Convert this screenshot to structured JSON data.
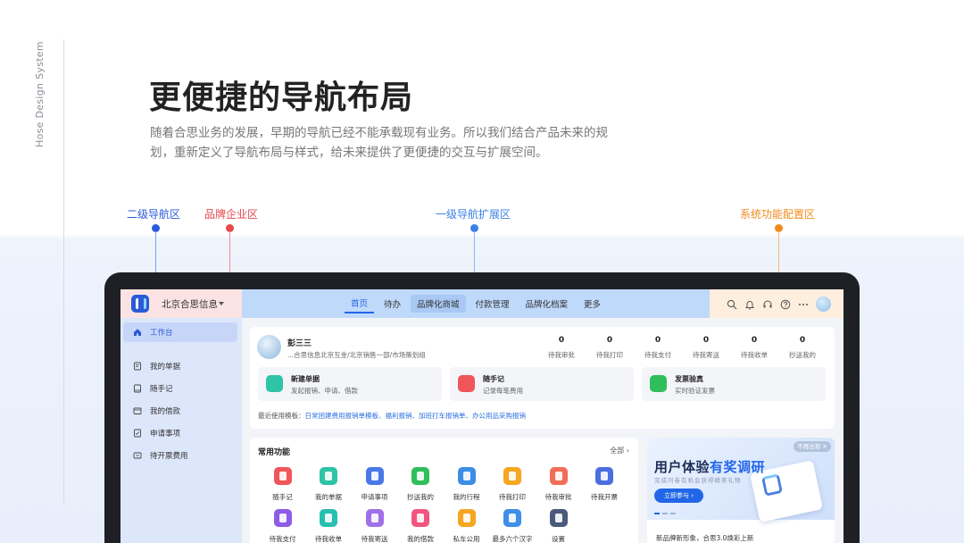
{
  "brand": {
    "system_name": "Hose Design System"
  },
  "headline": "更便捷的导航布局",
  "description": "随着合思业务的发展，早期的导航已经不能承载现有业务。所以我们结合产品未来的规划，重新定义了导航布局与样式，给未来提供了更便捷的交互与扩展空间。",
  "callouts": {
    "secondary_nav": {
      "label": "二级导航区",
      "color": "#2a5bd7"
    },
    "brand_area": {
      "label": "品牌企业区",
      "color": "#e5484d"
    },
    "primary_nav": {
      "label": "一级导航扩展区",
      "color": "#3b82e6"
    },
    "system_area": {
      "label": "系统功能配置区",
      "color": "#f08c1b"
    }
  },
  "app": {
    "company": "北京合思信息",
    "nav": [
      "首页",
      "待办",
      "品牌化商城",
      "付款管理",
      "品牌化档案",
      "更多"
    ],
    "sidebar": [
      "工作台",
      "我的单据",
      "随手记",
      "我的借款",
      "申请事项",
      "待开票费用"
    ],
    "user": {
      "name": "彭三三",
      "org": "...合思信息北京互金/北京销售一部/市场策划组"
    },
    "stats": [
      {
        "value": "0",
        "label": "待我审批"
      },
      {
        "value": "0",
        "label": "待我打印"
      },
      {
        "value": "0",
        "label": "待我支付"
      },
      {
        "value": "0",
        "label": "待我寄送"
      },
      {
        "value": "0",
        "label": "待我收单"
      },
      {
        "value": "0",
        "label": "抄送我的"
      }
    ],
    "quick_actions": [
      {
        "title": "新建单据",
        "subtitle": "发起报销、申请、借款",
        "color": "#2ec4a6"
      },
      {
        "title": "随手记",
        "subtitle": "记录每笔费用",
        "color": "#f0555a"
      },
      {
        "title": "发票验真",
        "subtitle": "实时验证发票",
        "color": "#2fbf5a"
      }
    ],
    "recent_templates": {
      "label": "最近使用模板：",
      "links": "日常团建费用报销单模板、福利报销、加班打车报销单、办公用品采购报销"
    },
    "common": {
      "title": "常用功能",
      "more": "全部",
      "items": [
        {
          "label": "随手记",
          "color": "#f0555a"
        },
        {
          "label": "我的单据",
          "color": "#2ec4a6"
        },
        {
          "label": "申请事项",
          "color": "#4a78e8"
        },
        {
          "label": "抄送我的",
          "color": "#2fbf5a"
        },
        {
          "label": "我的行程",
          "color": "#3a8ee6"
        },
        {
          "label": "待我打印",
          "color": "#f5a623"
        },
        {
          "label": "待我审批",
          "color": "#f06e5a"
        },
        {
          "label": "待我开票",
          "color": "#4a6fe0"
        },
        {
          "label": "待我支付",
          "color": "#8e5ce6"
        },
        {
          "label": "待我收单",
          "color": "#26bfb2"
        },
        {
          "label": "待我寄送",
          "color": "#a070e8"
        },
        {
          "label": "我的借款",
          "color": "#f0567e"
        },
        {
          "label": "私车公用",
          "color": "#f5a623"
        },
        {
          "label": "最多六个汉字",
          "color": "#3f8ee8"
        },
        {
          "label": "设置",
          "color": "#4a5a7a"
        }
      ]
    },
    "promo": {
      "close": "不再出现",
      "title_a": "用户体验",
      "title_b": "有奖调研",
      "subtitle": "完成问卷有机会获得精美礼物",
      "button": "立即参与",
      "news": "新品牌新形象，合思3.0焕彩上新"
    }
  }
}
